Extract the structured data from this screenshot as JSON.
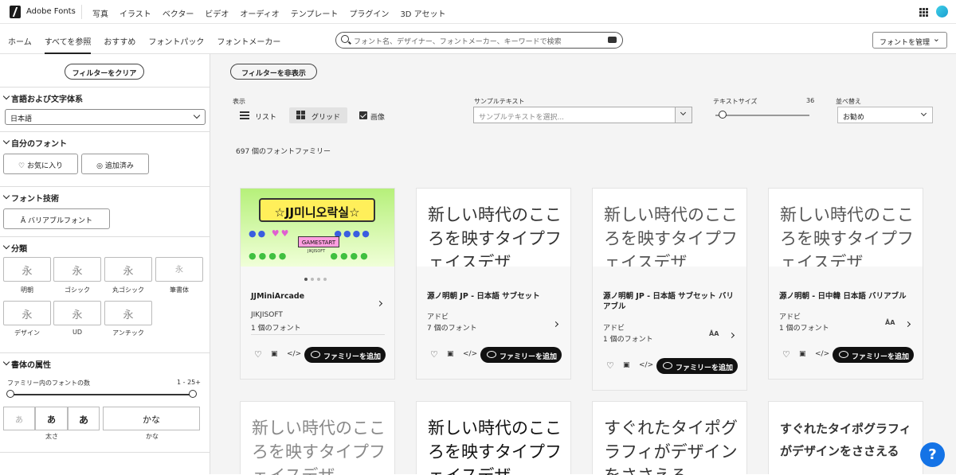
{
  "topbar": {
    "brand": "Adobe Fonts",
    "nav": [
      "写真",
      "イラスト",
      "ベクター",
      "ビデオ",
      "オーディオ",
      "テンプレート",
      "プラグイン",
      "3D アセット"
    ]
  },
  "subnav": {
    "items": [
      "ホーム",
      "すべてを参照",
      "おすすめ",
      "フォントパック",
      "フォントメーカー"
    ],
    "active": 1
  },
  "search": {
    "placeholder": "フォント名、デザイナー、フォントメーカー、キーワードで検索"
  },
  "manage_button": "フォントを管理",
  "sidebar": {
    "clear_filters": "フィルターをクリア",
    "lang_title": "言語および文字体系",
    "lang_value": "日本語",
    "myfonts_title": "自分のフォント",
    "favorites": "お気に入り",
    "added": "追加済み",
    "tech_title": "フォント技術",
    "variable": "バリアブルフォント",
    "class_title": "分類",
    "class_glyph": "永",
    "classes": [
      "明朝",
      "ゴシック",
      "丸ゴシック",
      "筆書体",
      "デザイン",
      "UD",
      "アンチック"
    ],
    "props_title": "書体の属性",
    "family_count_label": "ファミリー内のフォントの数",
    "family_count_range": "1 - 25+",
    "weight_glyph": "あ",
    "weight_label": "太さ",
    "kana_glyph": "かな",
    "kana_label": "かな"
  },
  "main": {
    "hide_filters": "フィルターを非表示",
    "display_label": "表示",
    "list_label": "リスト",
    "grid_label": "グリッド",
    "image_label": "画像",
    "sample_label": "サンプルテキスト",
    "sample_placeholder": "サンプルテキストを選択...",
    "size_label": "テキストサイズ",
    "size_value": "36",
    "size_fraction": 0.08,
    "sort_label": "並べ替え",
    "sort_value": "お勧め",
    "result_count": "697 個のフォントファミリー"
  },
  "cards": [
    {
      "name": "JJMiniArcade",
      "foundry": "JIKJISOFT",
      "count": "1 個のフォント",
      "preview": ""
    },
    {
      "name": "源ノ明朝 JP - 日本語 サブセット",
      "foundry": "アドビ",
      "count": "7 個のフォント",
      "preview": "新しい時代のこころを映すタイプフェイスデザ"
    },
    {
      "name": "源ノ明朝 JP - 日本語 サブセット バリアブル",
      "foundry": "アドビ",
      "count": "1 個のフォント",
      "preview": "新しい時代のこころを映すタイプフェイスデザ"
    },
    {
      "name": "源ノ明朝 - 日中韓 日本語 バリアブル",
      "foundry": "アドビ",
      "count": "1 個のフォント",
      "preview": "新しい時代のこころを映すタイプフェイスデザ"
    },
    {
      "preview": "新しい時代のこころを映すタイプフェイスデザ"
    },
    {
      "preview": "新しい時代のこころを映すタイプフェイスデザ"
    },
    {
      "preview": "すぐれたタイポグラフィがデザインをささえる"
    },
    {
      "preview": "すぐれたタイポグラフィがデザインをささえる"
    }
  ],
  "card_add_label": "ファミリーを追加",
  "vf_badge": "ÅA",
  "jj_preview": {
    "title": "☆JJ미니오락실☆",
    "button": "GAMESTART",
    "sub": "JIKJISOFT"
  },
  "help": "?"
}
